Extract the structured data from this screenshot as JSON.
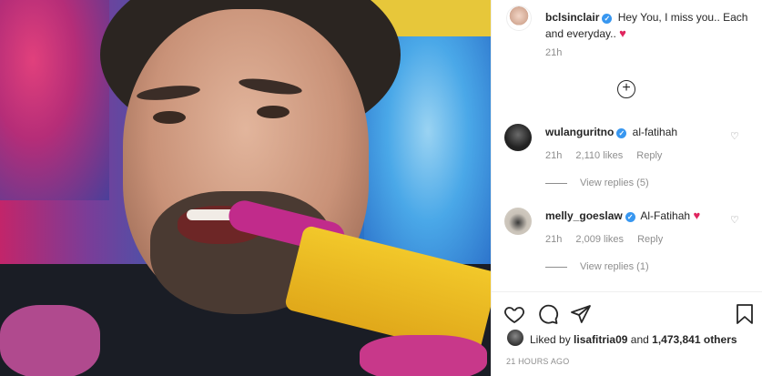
{
  "post": {
    "author": "bclsinclair",
    "caption": "Hey You, I miss you.. Each and everyday..",
    "caption_emoji": "♥",
    "time": "21h"
  },
  "comments": [
    {
      "username": "wulanguritno",
      "text": "al-fatihah",
      "emoji": "",
      "time": "21h",
      "likes": "2,110 likes",
      "reply": "Reply",
      "view_replies": "View replies (5)"
    },
    {
      "username": "melly_goeslaw",
      "text": "Al-Fatihah",
      "emoji": "♥",
      "time": "21h",
      "likes": "2,009 likes",
      "reply": "Reply",
      "view_replies": "View replies (1)"
    }
  ],
  "likes": {
    "prefix": "Liked by",
    "user": "lisafitria09",
    "joiner": "and",
    "others": "1,473,841 others"
  },
  "timestamp": "21 HOURS AGO",
  "colors": {
    "verified": "#3897f0",
    "heart": "#e0245e",
    "muted": "#8e8e8e",
    "text": "#262626"
  },
  "icons": {
    "like": "heart-outline-icon",
    "comment": "speech-bubble-icon",
    "share": "paper-plane-icon",
    "save": "bookmark-icon",
    "load_more": "plus-circle-icon",
    "verified": "verified-badge-icon"
  }
}
